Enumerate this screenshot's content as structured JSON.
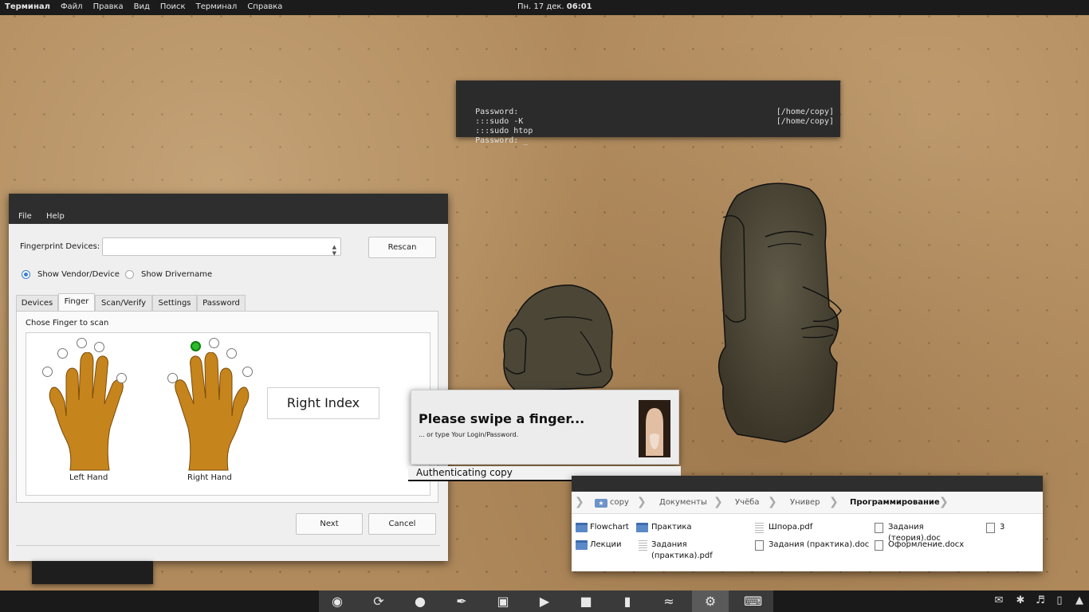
{
  "top_panel": {
    "app_name": "Терминал",
    "menus": [
      "Файл",
      "Правка",
      "Вид",
      "Поиск",
      "Терминал",
      "Справка"
    ],
    "date": "Пн. 17 дек.",
    "time": "06:01"
  },
  "terminal": {
    "lines": [
      {
        "left": "Password:",
        "right": ""
      },
      {
        "left": ":::sudo -K",
        "right": "[/home/copy]"
      },
      {
        "left": ":::sudo htop",
        "right": "[/home/copy]"
      },
      {
        "left": "Password: _",
        "right": ""
      }
    ]
  },
  "fingerprint_window": {
    "menu": {
      "file": "File",
      "help": "Help"
    },
    "devices_label": "Fingerprint Devices:",
    "devices_value": "",
    "rescan_label": "Rescan",
    "radio_vendor": "Show Vendor/Device",
    "radio_driver": "Show Drivername",
    "tabs": [
      "Devices",
      "Finger",
      "Scan/Verify",
      "Settings",
      "Password"
    ],
    "active_tab": "Finger",
    "instruction": "Chose Finger to scan",
    "left_hand": "Left Hand",
    "right_hand": "Right Hand",
    "selected_finger": "Right Index",
    "next_label": "Next",
    "cancel_label": "Cancel"
  },
  "auth_dialog": {
    "title": "Please swipe a finger...",
    "subtitle": "... or type Your Login/Password.",
    "status": "Authenticating copy"
  },
  "file_manager": {
    "breadcrumbs": [
      "copy",
      "Документы",
      "Учёба",
      "Универ",
      "Программирование"
    ],
    "items": [
      {
        "name": "Flowchart",
        "type": "folder"
      },
      {
        "name": "Практика",
        "type": "folder"
      },
      {
        "name": "Шпора.pdf",
        "type": "pdf"
      },
      {
        "name": "Задания (теория).doc",
        "type": "doc"
      },
      {
        "name": "3",
        "type": "doc"
      },
      {
        "name": "Лекции",
        "type": "folder"
      },
      {
        "name": "Задания (практика).pdf",
        "type": "pdf"
      },
      {
        "name": "Задания (практика).doc",
        "type": "doc"
      },
      {
        "name": "Оформление.docx",
        "type": "doc"
      }
    ]
  },
  "dock": {
    "apps": [
      "firefox-icon",
      "update-icon",
      "chat-icon",
      "inkscape-icon",
      "folder-icon",
      "play-icon",
      "notes-icon",
      "document-icon",
      "fish-icon",
      "settings-icon",
      "terminal-icon"
    ],
    "active_app": "settings-icon",
    "tray": [
      "message-icon",
      "bluetooth-icon",
      "volume-icon",
      "battery-icon",
      "signal-icon"
    ]
  }
}
